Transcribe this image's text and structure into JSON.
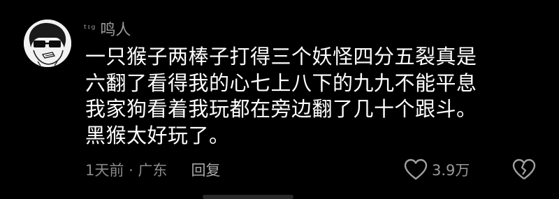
{
  "comment": {
    "user": {
      "badge": "ᵗᶦᵍ",
      "name": "鸣人"
    },
    "text_lines": [
      "一只猴子两棒子打得三个妖怪四分五裂真是",
      "六翻了看得我的心七上八下的九九不能平息",
      "我家狗看着我玩都在旁边翻了几十个跟斗。",
      "黑猴太好玩了。"
    ],
    "meta": {
      "time": "1天前",
      "separator": "·",
      "location": "广东",
      "reply_label": "回复"
    },
    "likes": {
      "count": "3.9万",
      "icon": "heart-outline-icon"
    },
    "dislike": {
      "icon": "broken-heart-icon"
    },
    "colors": {
      "background": "#000000",
      "primary_text": "#ffffff",
      "secondary_text": "#8a8a8a",
      "icon": "#a0a0a0"
    }
  }
}
